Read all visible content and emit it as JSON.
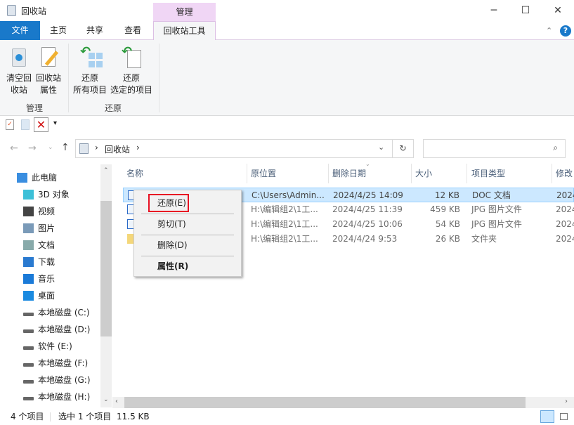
{
  "window": {
    "title": "回收站",
    "minimize": "─",
    "maximize": "☐",
    "close": "✕"
  },
  "ribbon_tabs": {
    "context_header": "管理",
    "file": "文件",
    "home": "主页",
    "share": "共享",
    "view": "查看",
    "tools": "回收站工具"
  },
  "ribbon": {
    "empty_l1": "清空回",
    "empty_l2": "收站",
    "props_l1": "回收站",
    "props_l2": "属性",
    "group_manage": "管理",
    "restore_all_l1": "还原",
    "restore_all_l2": "所有项目",
    "restore_sel_l1": "还原",
    "restore_sel_l2": "选定的项目",
    "group_restore": "还原"
  },
  "address": {
    "path": "回收站",
    "sep1": "›",
    "sep2": "›",
    "search_placeholder": ""
  },
  "nav": {
    "items": [
      "此电脑",
      "3D 对象",
      "视频",
      "图片",
      "文档",
      "下载",
      "音乐",
      "桌面",
      "本地磁盘 (C:)",
      "本地磁盘 (D:)",
      "软件 (E:)",
      "本地磁盘 (F:)",
      "本地磁盘 (G:)",
      "本地磁盘 (H:)"
    ]
  },
  "columns": [
    "名称",
    "原位置",
    "删除日期",
    "大小",
    "项目类型",
    "修改"
  ],
  "rows": [
    {
      "loc": "C:\\Users\\Admin...",
      "date": "2024/4/25 14:09",
      "size": "12 KB",
      "type": "DOC 文档",
      "mod": "2024"
    },
    {
      "loc": "H:\\编辑组2\\1工...",
      "date": "2024/4/25 11:39",
      "size": "459 KB",
      "type": "JPG 图片文件",
      "mod": "2024"
    },
    {
      "loc": "H:\\编辑组2\\1工...",
      "date": "2024/4/25 10:06",
      "size": "54 KB",
      "type": "JPG 图片文件",
      "mod": "2024"
    },
    {
      "loc": "H:\\编辑组2\\1工...",
      "date": "2024/4/24 9:53",
      "size": "26 KB",
      "type": "文件夹",
      "mod": "2024"
    }
  ],
  "context_menu": {
    "restore": "还原(E)",
    "cut": "剪切(T)",
    "delete": "删除(D)",
    "properties": "属性(R)"
  },
  "status": {
    "count": "4 个项目",
    "selected": "选中 1 个项目",
    "size": "11.5 KB"
  },
  "colors": {
    "accent": "#1979ca",
    "context_tab": "#f0d6f5",
    "selection": "#cce8ff",
    "highlight": "#e81123"
  }
}
